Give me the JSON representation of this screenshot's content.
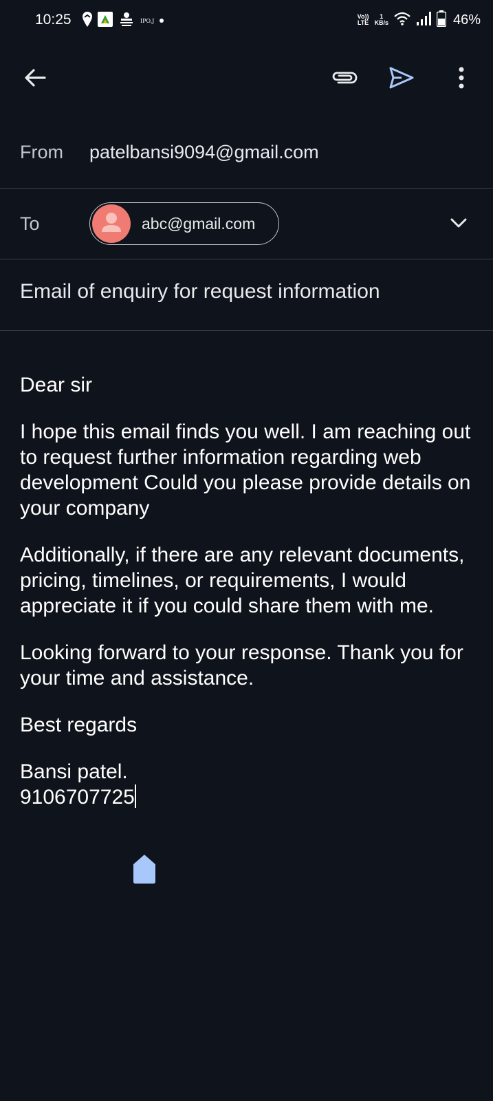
{
  "status_bar": {
    "time": "10:25",
    "volte_line1": "Vo))",
    "volte_line2": "LTE",
    "net_speed_value": "1",
    "net_speed_unit": "KB/s",
    "battery": "46%",
    "ipo_label": "IPO.J"
  },
  "toolbar": {
    "back_label": "Back",
    "attach_label": "Attach file",
    "send_label": "Send",
    "more_label": "More options"
  },
  "compose": {
    "from_label": "From",
    "from_value": "patelbansi9094@gmail.com",
    "to_label": "To",
    "to_recipients": [
      "abc@gmail.com"
    ],
    "subject": "Email of enquiry for request information",
    "body_paragraphs": [
      "Dear sir",
      "I hope this email finds you well. I am reaching out to request further information regarding web development  Could you please provide details on your company",
      "Additionally, if there are any relevant documents, pricing, timelines, or requirements, I would appreciate it if you could share them with me.",
      "Looking forward to your response. Thank you for your time and assistance.",
      "Best regards"
    ],
    "signature_name": "Bansi patel.",
    "signature_phone": "9106707725"
  },
  "colors": {
    "background": "#0f131b",
    "accent_send": "#a8c7fa",
    "avatar": "#f07b72",
    "divider": "#3b3f47"
  },
  "icons": {
    "back": "arrow-left-icon",
    "attach": "paperclip-icon",
    "send": "send-icon",
    "more": "more-vertical-icon",
    "expand": "chevron-down-icon",
    "avatar": "person-icon"
  }
}
